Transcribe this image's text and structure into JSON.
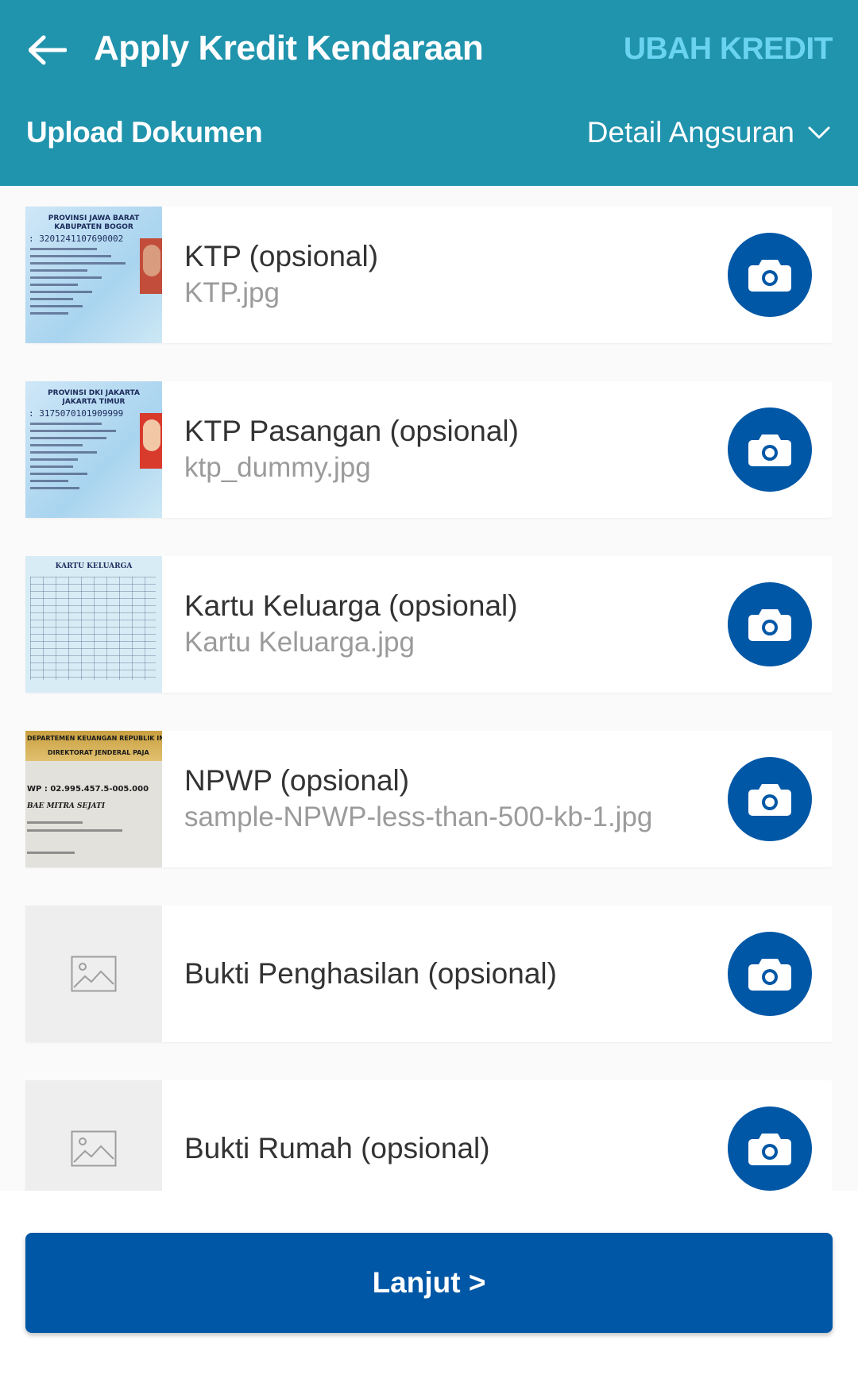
{
  "header": {
    "title": "Apply Kredit Kendaraan",
    "action": "UBAH KREDIT",
    "subtitle": "Upload Dokumen",
    "detail_toggle": "Detail Angsuran"
  },
  "documents": [
    {
      "title": "KTP (opsional)",
      "file": "KTP.jpg"
    },
    {
      "title": "KTP Pasangan (opsional)",
      "file": "ktp_dummy.jpg"
    },
    {
      "title": "Kartu Keluarga (opsional)",
      "file": "Kartu Keluarga.jpg"
    },
    {
      "title": "NPWP (opsional)",
      "file": "sample-NPWP-less-than-500-kb-1.jpg"
    },
    {
      "title": "Bukti Penghasilan (opsional)",
      "file": ""
    },
    {
      "title": "Bukti Rumah (opsional)",
      "file": ""
    }
  ],
  "thumbnails": {
    "ktp1": {
      "header": "PROVINSI JAWA BARAT\nKABUPATEN BOGOR",
      "nik": ": 3201241107690002"
    },
    "ktp2": {
      "header": "PROVINSI DKI JAKARTA\nJAKARTA TIMUR",
      "nik": ": 3175070101909999"
    },
    "kk": {
      "header": "KARTU KELUARGA"
    },
    "npwp": {
      "line1": "DEPARTEMEN KEUANGAN REPUBLIK IN",
      "line2": "DIREKTORAT JENDERAL PAJA",
      "number": "WP : 02.995.457.5-005.000",
      "name": "BAE MITRA SEJATI"
    }
  },
  "footer": {
    "button": "Lanjut >"
  },
  "colors": {
    "header_bg": "#2093ad",
    "accent_light": "#6ad3f2",
    "primary": "#0057a6",
    "muted_text": "#9b9b9b"
  },
  "icons": {
    "back": "arrow-left-icon",
    "chevron": "chevron-down-icon",
    "camera": "camera-icon",
    "image_placeholder": "image-placeholder-icon"
  }
}
